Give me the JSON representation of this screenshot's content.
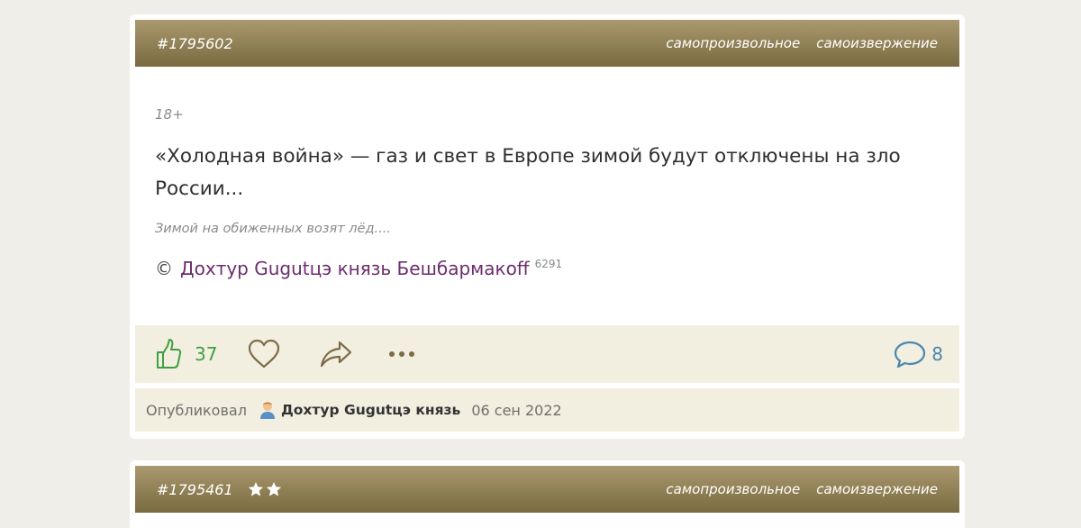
{
  "posts": [
    {
      "id": "#1795602",
      "tags": [
        "самопроизвольное",
        "самоизвержение"
      ],
      "age_label": "18+",
      "text": "«Холодная война» — газ и свет в Европе зимой будут отключены на зло России...",
      "caption": "Зимой на обиженных возят лёд....",
      "copyright": "©",
      "author": "Дохтур Gugutцэ князь Бешбармакoff",
      "author_rating": "6291",
      "likes": "37",
      "comments": "8",
      "published_label": "Опубликовал",
      "publisher": "Дохтур Gugutцэ князь",
      "date": "06 сен 2022",
      "icons": {
        "like": "thumbs-up-icon",
        "favorite": "heart-icon",
        "share": "share-arrow-icon",
        "more": "more-dots-icon",
        "comments": "comment-bubble-icon",
        "user": "user-avatar-icon"
      }
    },
    {
      "id": "#1795461",
      "stars": 2,
      "tags": [
        "самопроизвольное",
        "самоизвержение"
      ]
    }
  ],
  "colors": {
    "header_top": "#ab9970",
    "header_bottom": "#7a6a40",
    "likes": "#3fa03f",
    "comments": "#4a88b0",
    "author_link": "#6b2e6e",
    "panel_bg": "#f2eee0",
    "page_bg": "#efeee8"
  }
}
